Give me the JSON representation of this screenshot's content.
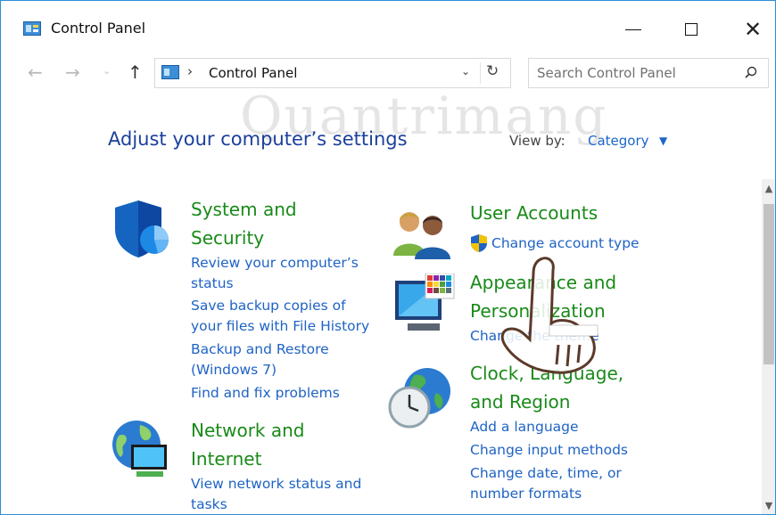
{
  "window": {
    "title": "Control Panel"
  },
  "titlebar_buttons": {
    "minimize": "—",
    "maximize": "☐",
    "close": "✕"
  },
  "nav": {
    "back": "←",
    "forward": "→",
    "recent": "⌄",
    "up": "↑"
  },
  "address": {
    "separator": "›",
    "path": "Control Panel",
    "dropdown": "⌄",
    "refresh": "↻"
  },
  "search": {
    "placeholder": "Search Control Panel"
  },
  "header": {
    "title": "Adjust your computer’s settings",
    "view_by_label": "View by:",
    "view_by_value": "Category",
    "view_by_arrow": "▼"
  },
  "watermark": "Quantrimang",
  "categories": [
    {
      "id": "system-and-security",
      "title_lines": [
        "System and",
        "Security"
      ],
      "icon": "shield-icon",
      "tasks": [
        [
          "Review your computer’s",
          "status"
        ],
        [
          "Save backup copies of",
          "your files with File History"
        ],
        [
          "Backup and Restore",
          "(Windows 7)"
        ],
        [
          "Find and fix problems"
        ]
      ]
    },
    {
      "id": "network-and-internet",
      "title_lines": [
        "Network and",
        "Internet"
      ],
      "icon": "network-globe-icon",
      "tasks": [
        [
          "View network status and",
          "tasks"
        ]
      ]
    },
    {
      "id": "user-accounts",
      "title_lines": [
        "User Accounts"
      ],
      "icon": "users-icon",
      "tasks": [
        [
          "Change account type"
        ]
      ]
    },
    {
      "id": "appearance-and-personalization",
      "title_lines": [
        "Appearance and",
        "Personalization"
      ],
      "icon": "monitor-palette-icon",
      "tasks": [
        [
          "Change the theme"
        ]
      ]
    },
    {
      "id": "clock-language-region",
      "title_lines": [
        "Clock, Language,",
        "and Region"
      ],
      "icon": "clock-globe-icon",
      "tasks": [
        [
          "Add a language"
        ],
        [
          "Change input methods"
        ],
        [
          "Change date, time, or",
          "number formats"
        ]
      ]
    }
  ],
  "scrollbar": {
    "up": "▲",
    "down": "▼"
  },
  "colors": {
    "accent_link": "#1f63c4",
    "category_green": "#198a19",
    "title_blue": "#1b3f9c",
    "window_border": "#2b8fd8"
  }
}
